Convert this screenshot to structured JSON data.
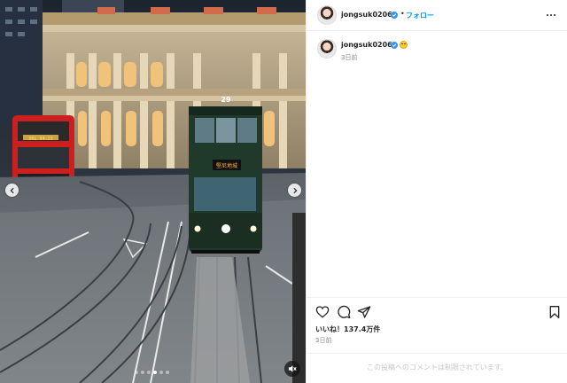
{
  "post": {
    "username": "jongsuk0206",
    "follow_label": "フォロー",
    "dot_separator": "•",
    "caption_time": "3日前",
    "likes_label": "いいね！137.4万件",
    "post_date": "3日前",
    "comments_disabled_text": "この投稿へのコメントは制限されています。"
  },
  "media": {
    "tram_number": "29",
    "tram_sign": "堅尼地城",
    "bus_display": "DRL 94.23",
    "carousel_count": 6,
    "carousel_active_index": 3
  },
  "icons": {
    "verified": "verified-badge-icon",
    "more": "more-options-icon",
    "like": "heart-icon",
    "comment": "comment-bubble-icon",
    "share": "paper-plane-icon",
    "save": "bookmark-icon",
    "prev": "chevron-left-icon",
    "next": "chevron-right-icon",
    "mute": "speaker-muted-icon"
  },
  "colors": {
    "accent": "#0095f6",
    "verified": "#3897f0",
    "text": "#262626",
    "muted": "#8e8e8e"
  }
}
